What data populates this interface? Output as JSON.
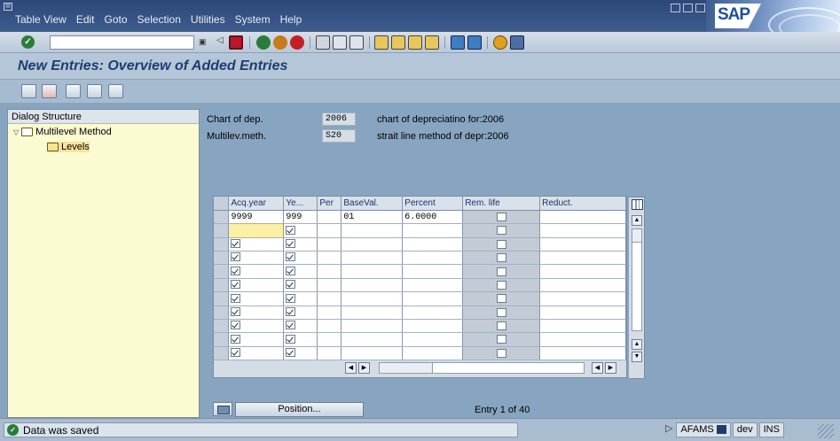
{
  "menu": {
    "items": [
      "Table View",
      "Edit",
      "Goto",
      "Selection",
      "Utilities",
      "System",
      "Help"
    ]
  },
  "brand": {
    "logo_text": "SAP"
  },
  "toolbar": {
    "command_value": ""
  },
  "page": {
    "title": "New Entries: Overview of Added Entries"
  },
  "dialog": {
    "header": "Dialog Structure",
    "tree": [
      {
        "label": "Multilevel Method",
        "expanded": true
      },
      {
        "label": "Levels",
        "selected": true
      }
    ]
  },
  "fields": [
    {
      "label": "Chart of dep.",
      "value": "2006",
      "description": "chart of depreciatino for:2006"
    },
    {
      "label": "Multilev.meth.",
      "value": "S20",
      "description": "strait line method of depr:2006"
    }
  ],
  "table": {
    "columns": [
      "Acq.year",
      "Ye...",
      "Per",
      "BaseVal.",
      "Percent",
      "Rem. life",
      "Reduct."
    ],
    "rows": [
      {
        "acq_year": "9999",
        "year": "999",
        "per": "",
        "base_val": "01",
        "percent": "6.0000",
        "rem_life": false,
        "reduct": "",
        "acq_check": null,
        "year_check": null
      },
      {
        "acq_year": "",
        "year": "",
        "per": "",
        "base_val": "",
        "percent": "",
        "rem_life": false,
        "reduct": "",
        "acq_check": null,
        "year_check": true
      },
      {
        "acq_year": "",
        "year": "",
        "per": "",
        "base_val": "",
        "percent": "",
        "rem_life": false,
        "reduct": "",
        "acq_check": true,
        "year_check": true
      },
      {
        "acq_year": "",
        "year": "",
        "per": "",
        "base_val": "",
        "percent": "",
        "rem_life": false,
        "reduct": "",
        "acq_check": true,
        "year_check": true
      },
      {
        "acq_year": "",
        "year": "",
        "per": "",
        "base_val": "",
        "percent": "",
        "rem_life": false,
        "reduct": "",
        "acq_check": true,
        "year_check": true
      },
      {
        "acq_year": "",
        "year": "",
        "per": "",
        "base_val": "",
        "percent": "",
        "rem_life": false,
        "reduct": "",
        "acq_check": true,
        "year_check": true
      },
      {
        "acq_year": "",
        "year": "",
        "per": "",
        "base_val": "",
        "percent": "",
        "rem_life": false,
        "reduct": "",
        "acq_check": true,
        "year_check": true
      },
      {
        "acq_year": "",
        "year": "",
        "per": "",
        "base_val": "",
        "percent": "",
        "rem_life": false,
        "reduct": "",
        "acq_check": true,
        "year_check": true
      },
      {
        "acq_year": "",
        "year": "",
        "per": "",
        "base_val": "",
        "percent": "",
        "rem_life": false,
        "reduct": "",
        "acq_check": true,
        "year_check": true
      },
      {
        "acq_year": "",
        "year": "",
        "per": "",
        "base_val": "",
        "percent": "",
        "rem_life": false,
        "reduct": "",
        "acq_check": true,
        "year_check": true
      },
      {
        "acq_year": "",
        "year": "",
        "per": "",
        "base_val": "",
        "percent": "",
        "rem_life": false,
        "reduct": "",
        "acq_check": true,
        "year_check": true
      }
    ]
  },
  "footer": {
    "position_label": "Position...",
    "entry_text": "Entry 1 of 40"
  },
  "status": {
    "message": "Data was saved",
    "system": "AFAMS",
    "client": "dev",
    "mode": "INS"
  },
  "colors": {
    "menubar": "#2c4878",
    "background": "#87a5c0",
    "title": "#1d3d72",
    "tree_bg": "#fafbd1",
    "ok_green": "#2a7c3a"
  }
}
